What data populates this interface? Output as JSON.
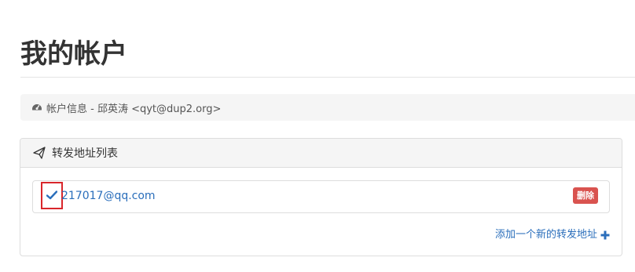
{
  "header": {
    "title": "我的帐户"
  },
  "account": {
    "icon": "dashboard-icon",
    "info": "帐户信息 - 邱英涛 <qyt@dup2.org>"
  },
  "forwarding_panel": {
    "icon": "paper-plane-icon",
    "title": "转发地址列表",
    "addresses": [
      {
        "email": "217017@qq.com",
        "status_icon": "check-icon",
        "delete_label": "删除"
      }
    ],
    "add_label": "添加一个新的转发地址",
    "add_icon": "plus-icon"
  },
  "colors": {
    "link": "#2a6ebb",
    "danger": "#d9534f",
    "highlight_box": "#d9262b"
  }
}
